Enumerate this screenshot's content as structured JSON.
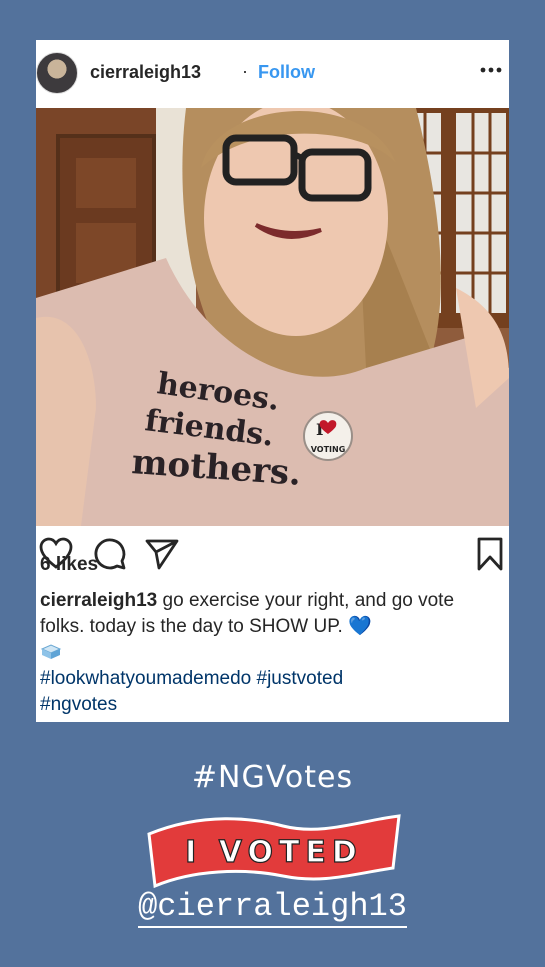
{
  "post": {
    "username": "cierraleigh13",
    "separator": "·",
    "follow_label": "Follow",
    "likes": "6 likes",
    "caption_user": "cierraleigh13",
    "caption_text": " go exercise your right, and go vote folks. today is the day to SHOW UP. 💙",
    "hashtags_line1": "#lookwhatyoumademedo #justvoted",
    "hashtags_line2": "#ngvotes",
    "shirt_text": [
      "heroes.",
      "friends.",
      "mothers."
    ],
    "pin_text": [
      "I",
      "VOTING"
    ]
  },
  "story": {
    "hashtag": "#NGVotes",
    "sticker_text": "I VOTED",
    "mention": "@cierraleigh13"
  },
  "colors": {
    "background": "#53729c",
    "follow": "#3897f0",
    "hashtag": "#003569",
    "sticker_red": "#e23b3b"
  }
}
